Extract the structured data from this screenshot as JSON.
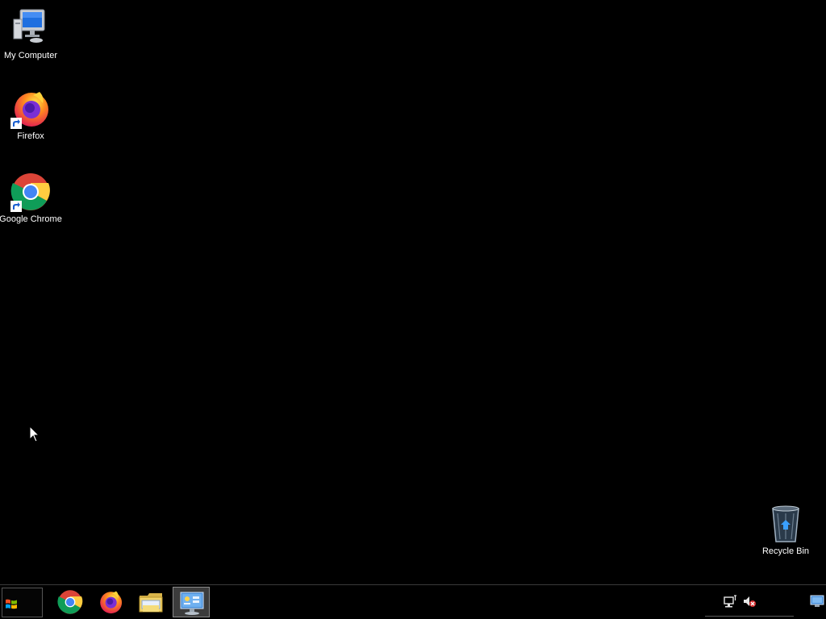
{
  "desktop": {
    "icons": {
      "my_computer": "My Computer",
      "firefox": "Firefox",
      "chrome": "Google Chrome",
      "recycle_bin": "Recycle Bin"
    }
  },
  "taskbar": {
    "pinned": [
      "chrome-icon",
      "firefox-icon",
      "file-explorer-icon",
      "control-panel-icon"
    ],
    "active_app": "control-panel-icon"
  },
  "tray": {
    "icons": [
      "network-icon",
      "volume-muted-icon",
      "show-desktop-icon"
    ]
  },
  "colors": {
    "background": "#000000",
    "taskbar": "#000000",
    "active_highlight": "#3c3c3c"
  }
}
